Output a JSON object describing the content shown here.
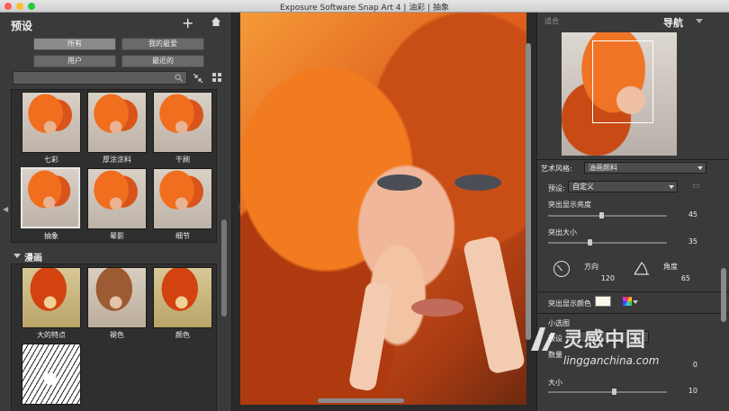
{
  "window": {
    "title": "Exposure Software Snap Art 4 | 油彩 | 抽象"
  },
  "left_panel": {
    "title": "预设",
    "filters": [
      "所有",
      "我的最爱",
      "用户",
      "最近的"
    ],
    "search": {
      "placeholder": ""
    },
    "oil_presets": [
      {
        "label": "七彩"
      },
      {
        "label": "厚涂涂料"
      },
      {
        "label": "干刷"
      },
      {
        "label": "抽象"
      },
      {
        "label": "晕影"
      },
      {
        "label": "细节"
      }
    ],
    "section": {
      "label": "漫画"
    },
    "comic_presets": [
      {
        "label": "大的特点"
      },
      {
        "label": "褪色"
      },
      {
        "label": "颜色"
      },
      {
        "label": ""
      }
    ]
  },
  "right_panel": {
    "fit_label": "适合",
    "nav_title": "导航",
    "art_style_label": "艺术风格:",
    "art_style_value": "油画颜料",
    "preset_label": "预设:",
    "preset_value": "自定义",
    "highlight_brightness_label": "突出显示亮度",
    "highlight_brightness_value": "45",
    "highlight_size_label": "突出大小",
    "highlight_size_value": "35",
    "direction_label": "方向",
    "direction_value": "120",
    "angle_label": "角度",
    "angle_value": "65",
    "highlight_color_label": "突出显示颜色",
    "small_strokes_label": "小选图",
    "preset2_label": "预设",
    "preset2_value": "",
    "count_label": "数量",
    "count_value": "0",
    "size_label": "大小",
    "size_value": "10"
  },
  "sliders": {
    "highlight_brightness": 0.45,
    "highlight_size": 0.35,
    "size": 0.55
  },
  "watermark": {
    "brand": "灵感中国",
    "site": "lingganchina.com"
  },
  "colors": {
    "accent": "#f06e1e",
    "panel_bg": "#3a3a3a",
    "canvas_bg": "#2a2a2a"
  }
}
